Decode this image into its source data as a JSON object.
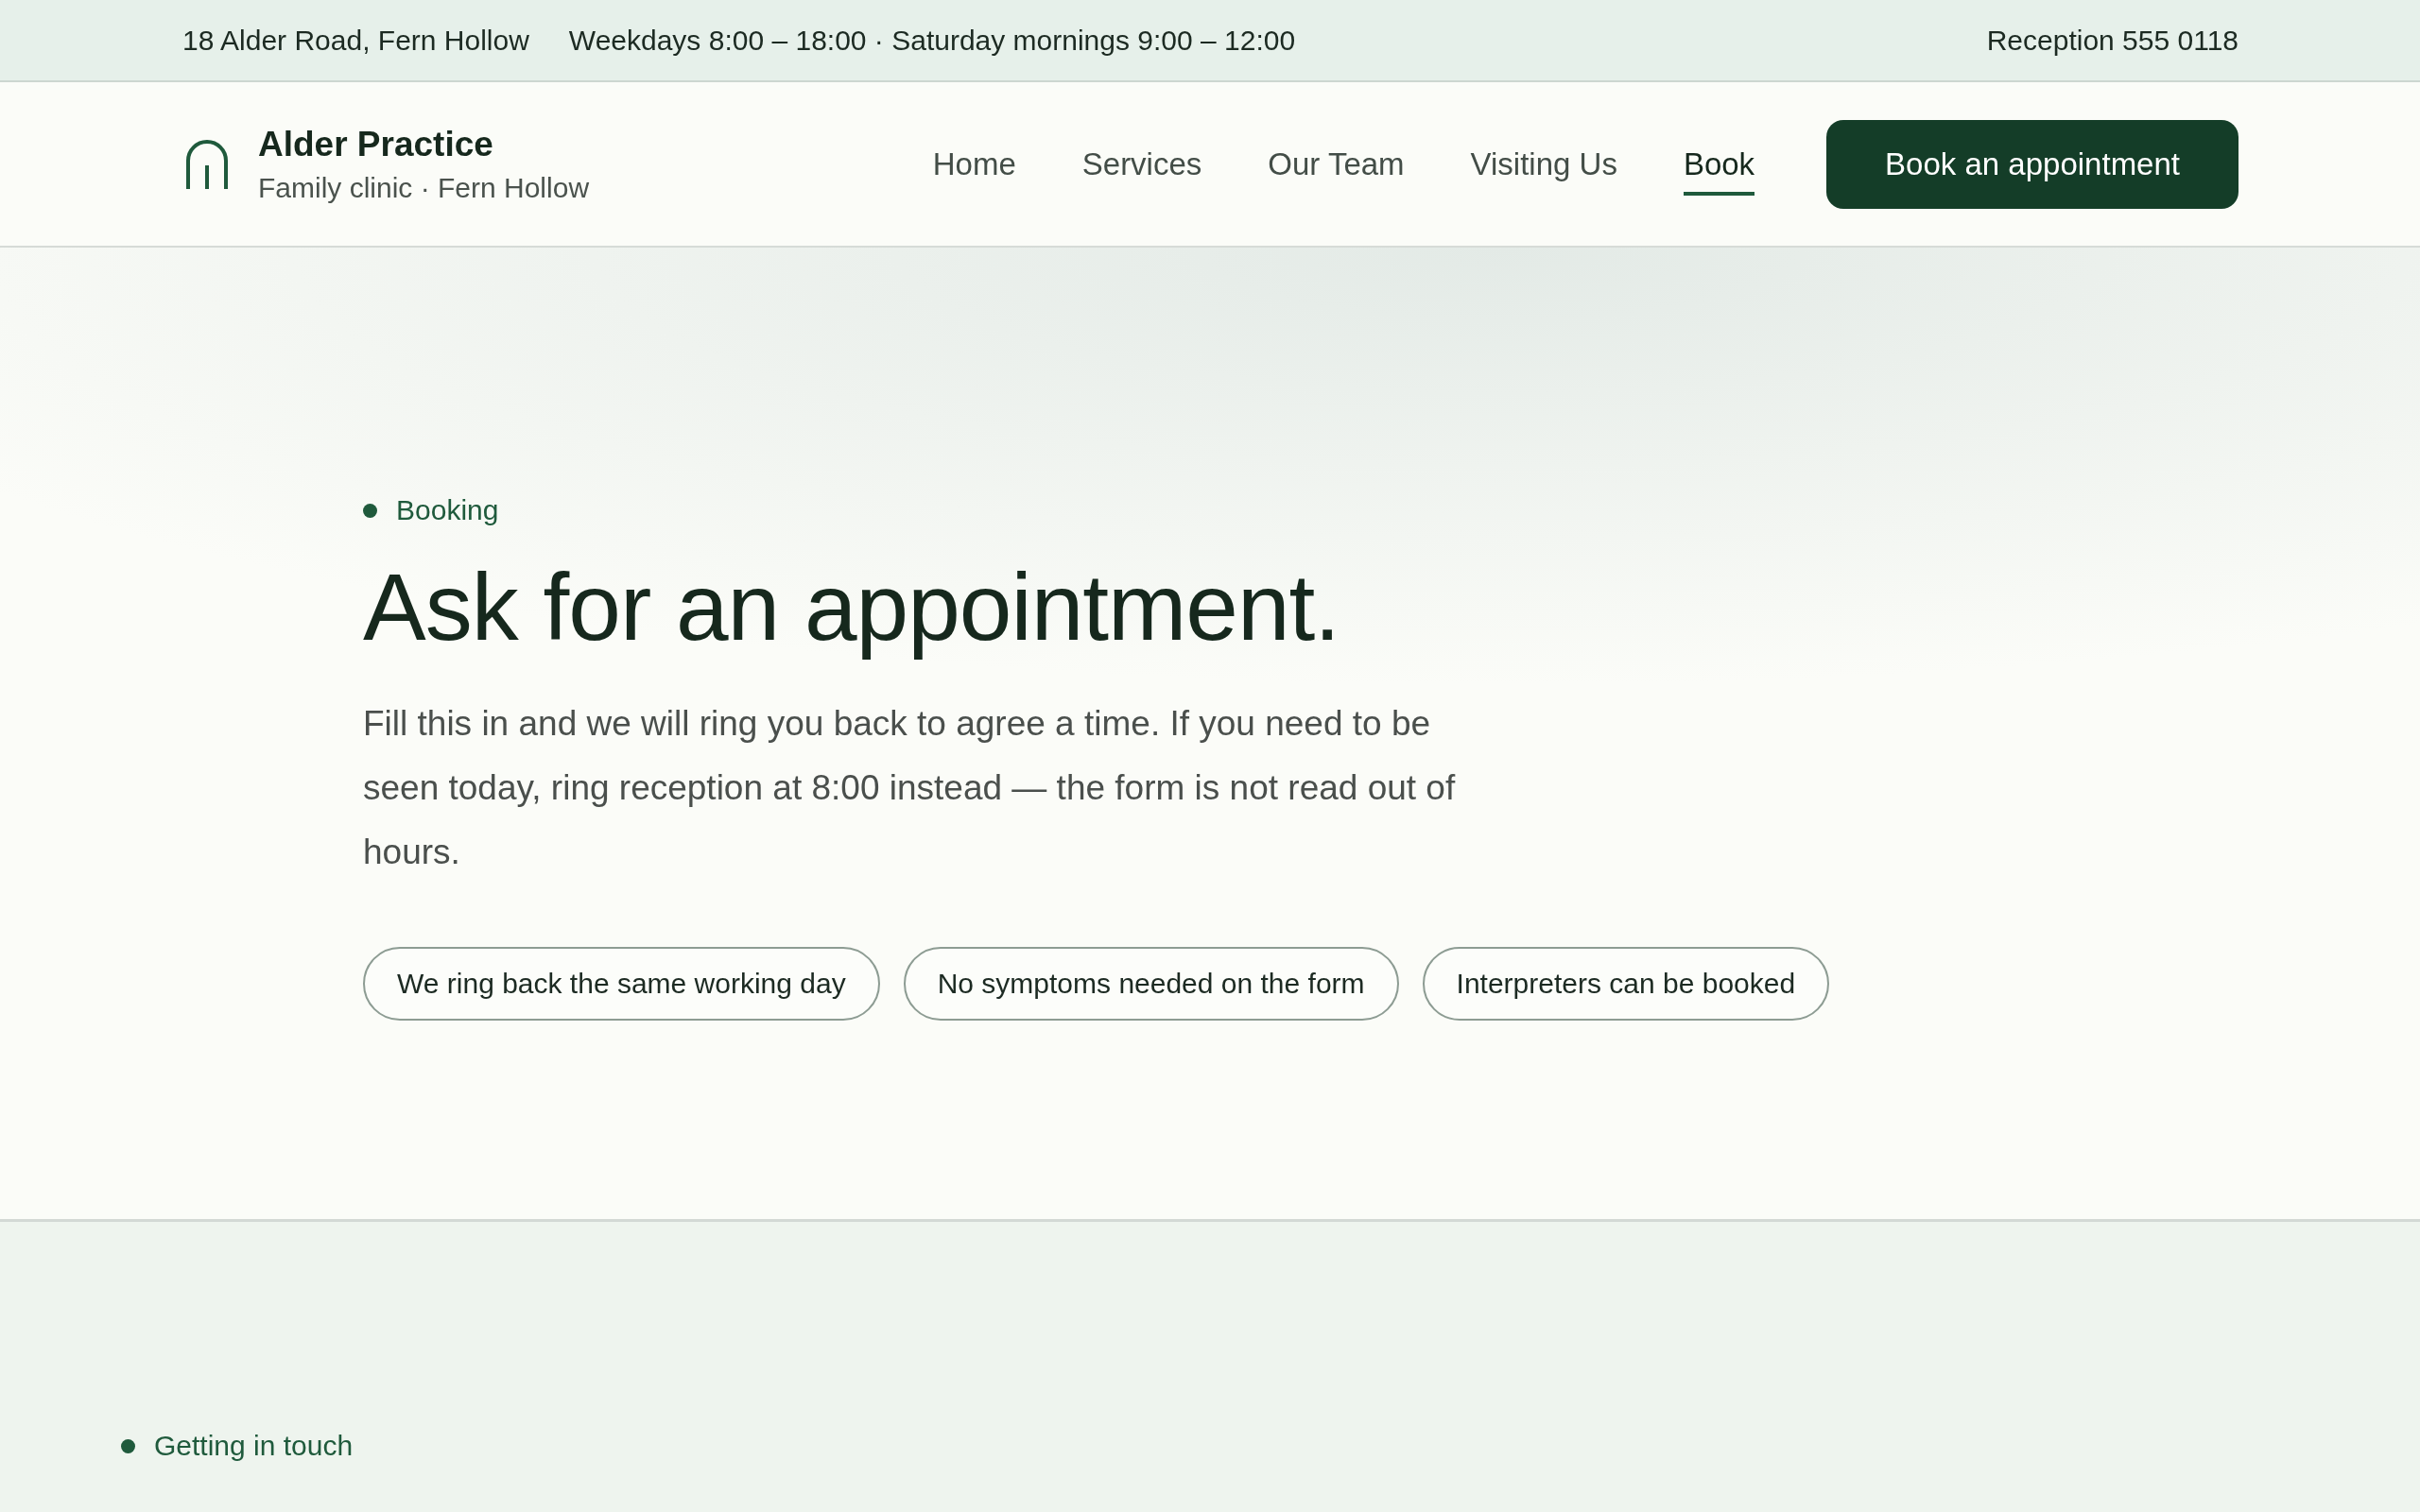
{
  "top_bar": {
    "address": "18 Alder Road, Fern Hollow",
    "hours": "Weekdays 8:00 – 18:00 · Saturday mornings 9:00 – 12:00",
    "phone": "Reception 555 0118"
  },
  "header": {
    "brand": {
      "name": "Alder Practice",
      "tagline": "Family clinic · Fern Hollow"
    },
    "nav": [
      {
        "label": "Home",
        "selected": false
      },
      {
        "label": "Services",
        "selected": false
      },
      {
        "label": "Our Team",
        "selected": false
      },
      {
        "label": "Visiting Us",
        "selected": false
      },
      {
        "label": "Book",
        "selected": true
      }
    ],
    "cta": "Book an appointment"
  },
  "hero": {
    "eyebrow": "Booking",
    "title": "Ask for an appointment.",
    "intro": "Fill this in and we will ring you back to agree a time. If you need to be seen today, ring reception at 8:00 instead — the form is not read out of hours.",
    "tags": [
      "We ring back the same working day",
      "No symptoms needed on the form",
      "Interpreters can be booked"
    ]
  },
  "contact_section": {
    "eyebrow": "Getting in touch"
  }
}
